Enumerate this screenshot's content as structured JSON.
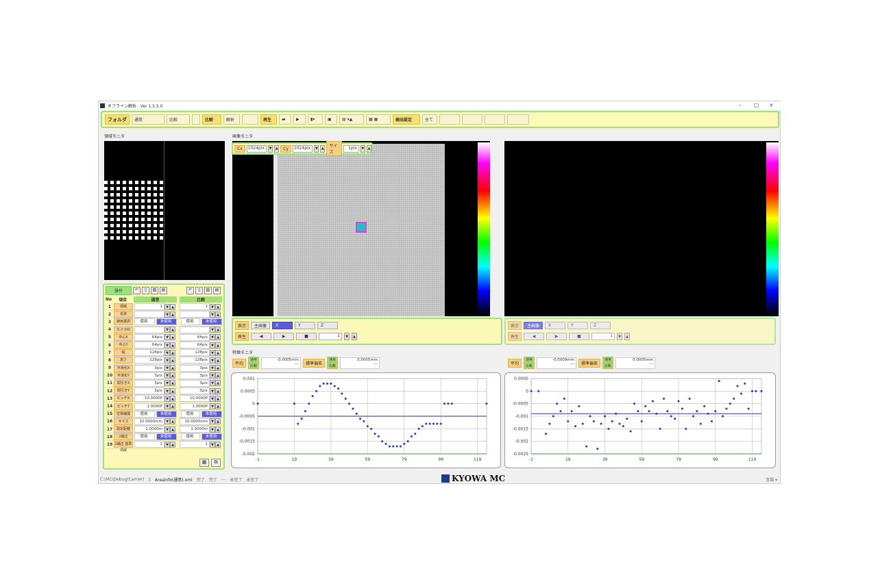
{
  "window": {
    "title": "オフライン解析 : Ver 1.5.5.0",
    "minimize": "–",
    "maximize": "▢",
    "close": "×"
  },
  "toolbar": {
    "folder": "フォルダ",
    "items": [
      "通常",
      "比較",
      "",
      "比較",
      "解析",
      "",
      "再生",
      "",
      "",
      "",
      "",
      "検出設定",
      "全て",
      "",
      "",
      "",
      ""
    ]
  },
  "region_monitor": {
    "title": "領域モニタ"
  },
  "image_monitor": {
    "title": "画像モニタ",
    "cx_label": "Cx",
    "cx_value": "1024pix",
    "cy_label": "Cy",
    "cy_value": "1024pix",
    "size_label": "サイズ",
    "size_value": "1pix",
    "left_ctrl": {
      "display": "表示",
      "main": "主画像",
      "x": "X",
      "y": "Y",
      "z": "Z",
      "play": "再生",
      "frame": "1"
    },
    "right_ctrl": {
      "display": "表示",
      "main": "主画像",
      "x": "X",
      "y": "Y",
      "z": "Z",
      "play": "再生",
      "frame": "1"
    }
  },
  "params": {
    "op_label": "操作",
    "no": "No",
    "item": "項目",
    "normal": "通常",
    "compare": "比較",
    "rows": [
      {
        "no": "1",
        "name": "領域",
        "v1": "1",
        "v2": "1"
      },
      {
        "no": "2",
        "name": "名称",
        "v1": "",
        "v2": ""
      },
      {
        "no": "3",
        "name": "使用選択",
        "v1": "使用",
        "v1b": "未使用",
        "v2": "使用",
        "v2b": "未使用"
      },
      {
        "no": "4",
        "name": "カメラID",
        "v1": "",
        "v2": ""
      },
      {
        "no": "5",
        "name": "中心X",
        "v1": "64pix",
        "v2": "64pix"
      },
      {
        "no": "6",
        "name": "中心Y",
        "v1": "64pix",
        "v2": "64pix"
      },
      {
        "no": "7",
        "name": "幅",
        "v1": "128pix",
        "v2": "128pix"
      },
      {
        "no": "8",
        "name": "高さ",
        "v1": "128pix",
        "v2": "128pix"
      },
      {
        "no": "9",
        "name": "平滑化X",
        "v1": "3pix",
        "v2": "3pix"
      },
      {
        "no": "10",
        "name": "平滑化Y",
        "v1": "3pix",
        "v2": "3pix"
      },
      {
        "no": "11",
        "name": "間引きX",
        "v1": "3pix",
        "v2": "3pix"
      },
      {
        "no": "12",
        "name": "間引きY",
        "v1": "3pix",
        "v2": "3pix"
      },
      {
        "no": "13",
        "name": "ピッチX",
        "v1": "10.0000P",
        "v2": "10.0000P"
      },
      {
        "no": "14",
        "name": "ピッチY",
        "v1": "1.0000P",
        "v2": "1.0000P"
      },
      {
        "no": "15",
        "name": "位相補償",
        "v1": "使用",
        "v1b": "未使用",
        "v2": "使用",
        "v2b": "未使用"
      },
      {
        "no": "16",
        "name": "サイズ",
        "v1": "10.0000mm",
        "v2": "10.0000mm"
      },
      {
        "no": "17",
        "name": "測定距離",
        "v1": "1.0000m",
        "v2": "1.0000m"
      },
      {
        "no": "18",
        "name": "2補正",
        "v1": "使用",
        "v1b": "未使用",
        "v2": "使用",
        "v2b": "未使用"
      },
      {
        "no": "19",
        "name": "2補正 基準領域",
        "v1": "1",
        "v2": "1"
      }
    ]
  },
  "trend_monitor": {
    "title": "特徴モニタ",
    "left": {
      "avg": "平均",
      "std": "標準偏差",
      "normal": "通常",
      "compare": "比較",
      "avg_val": "-0.0005mm",
      "avg_cmp": "---",
      "std_val": "0.0005mm",
      "std_cmp": "---"
    },
    "right": {
      "avg": "平均",
      "std": "標準偏差",
      "normal": "通常",
      "compare": "比較",
      "avg_val": "-0.0009mm",
      "avg_cmp": "---",
      "std_val": "0.0005mm",
      "std_cmp": "---"
    }
  },
  "chart_data": [
    {
      "type": "scatter",
      "x_ticks": [
        "-1",
        "19",
        "39",
        "59",
        "79",
        "99",
        "119"
      ],
      "y_ticks": [
        "0.001",
        "0.0005",
        "0",
        "-0.0005",
        "-0.001",
        "-0.0015",
        "-0.002"
      ],
      "xlim": [
        -1,
        124
      ],
      "ylim": [
        -0.002,
        0.001
      ],
      "mean_line": -0.0005,
      "series": [
        {
          "color": "#2233dd",
          "x": [
            -1,
            19,
            21,
            23,
            25,
            27,
            29,
            31,
            33,
            35,
            37,
            39,
            41,
            43,
            45,
            47,
            49,
            51,
            53,
            55,
            57,
            59,
            61,
            63,
            65,
            67,
            69,
            71,
            73,
            75,
            77,
            79,
            81,
            83,
            85,
            87,
            89,
            91,
            93,
            95,
            97,
            99,
            101,
            103,
            105,
            124
          ],
          "y": [
            0,
            0,
            -0.0008,
            -0.0006,
            -0.0003,
            0,
            0.0003,
            0.0005,
            0.0007,
            0.0008,
            0.0008,
            0.0008,
            0.0007,
            0.0006,
            0.0004,
            0.0002,
            0,
            -0.0002,
            -0.0004,
            -0.0006,
            -0.0007,
            -0.0009,
            -0.001,
            -0.0012,
            -0.0013,
            -0.0015,
            -0.0016,
            -0.0017,
            -0.0017,
            -0.0017,
            -0.0017,
            -0.0016,
            -0.0015,
            -0.0013,
            -0.0012,
            -0.001,
            -0.0009,
            -0.0008,
            -0.0008,
            -0.0008,
            -0.0008,
            -0.0008,
            0,
            0,
            0,
            0
          ]
        }
      ]
    },
    {
      "type": "scatter",
      "x_ticks": [
        "-1",
        "19",
        "39",
        "59",
        "79",
        "99",
        "119"
      ],
      "y_ticks": [
        "0.0005",
        "0",
        "-0.0005",
        "-0.001",
        "-0.0015",
        "-0.002",
        "-0.0025"
      ],
      "xlim": [
        -1,
        124
      ],
      "ylim": [
        -0.0025,
        0.0005
      ],
      "mean_line": -0.0009,
      "series": [
        {
          "color": "#2233dd",
          "x": [
            -1,
            3,
            7,
            9,
            11,
            13,
            15,
            17,
            19,
            21,
            23,
            25,
            27,
            29,
            31,
            33,
            35,
            37,
            39,
            41,
            43,
            45,
            47,
            49,
            51,
            53,
            55,
            57,
            59,
            61,
            63,
            65,
            67,
            69,
            71,
            73,
            75,
            77,
            79,
            81,
            83,
            85,
            87,
            89,
            91,
            93,
            95,
            97,
            99,
            101,
            103,
            105,
            107,
            109,
            111,
            113,
            115,
            117,
            119,
            121,
            124
          ],
          "y": [
            0,
            0,
            -0.0017,
            -0.0013,
            -0.001,
            -0.0005,
            -0.0008,
            -0.0003,
            -0.0012,
            -0.0008,
            -0.0014,
            -0.0006,
            -0.0013,
            -0.0022,
            -0.001,
            -0.0012,
            -0.0023,
            -0.0013,
            -0.001,
            -0.0015,
            -0.0012,
            -0.0009,
            -0.0013,
            -0.0014,
            -0.0011,
            -0.0016,
            -0.0005,
            -0.0008,
            -0.0012,
            -0.0006,
            -0.0008,
            -0.0004,
            -0.0009,
            -0.0015,
            -0.0003,
            -0.0008,
            -0.001,
            -0.0011,
            -0.0004,
            -0.0007,
            -0.0015,
            -0.0003,
            -0.001,
            -0.0008,
            -0.0013,
            -0.0006,
            -0.0009,
            -0.0012,
            -0.0008,
            0.0004,
            -0.001,
            -0.0007,
            -0.0005,
            -0.0003,
            0.0002,
            -0.0001,
            0.0003,
            -0.0007,
            0,
            0,
            0
          ]
        }
      ]
    }
  ],
  "status": {
    "path": "C:\\MC\\Debug(Carrier)",
    "file": "AreaInfo(通常).xml",
    "s1": "完了",
    "s2": "完了",
    "s3": "---",
    "s4": "未完了",
    "s5": "未完了",
    "brand": "KYOWA MC",
    "lang": "言語 ▾"
  }
}
